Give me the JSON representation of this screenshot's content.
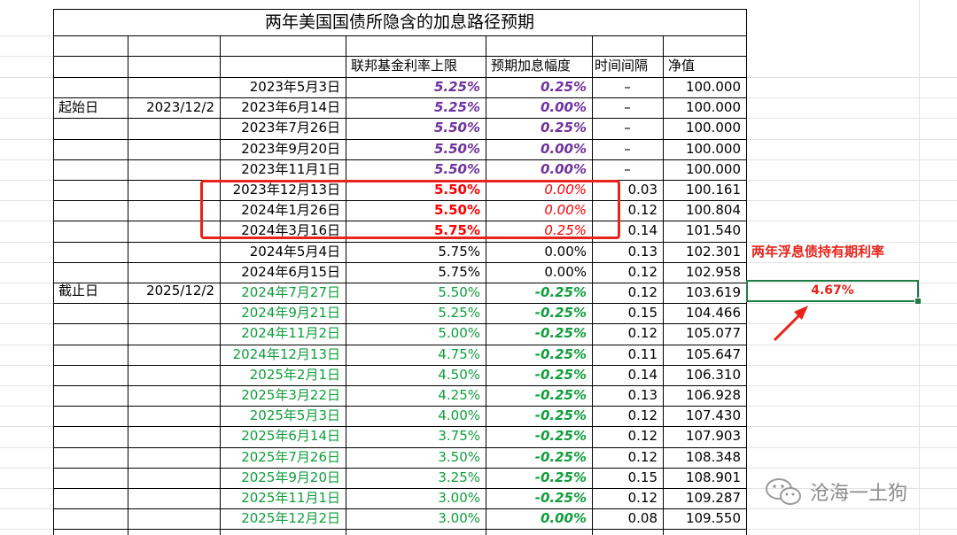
{
  "title": "两年美国国债所隐含的加息路径预期",
  "headers": {
    "fed_cap": "联邦基金利率上限",
    "hike": "预期加息幅度",
    "interval": "时间间隔",
    "nav": "净值"
  },
  "side_labels": {
    "start": {
      "label": "起始日",
      "date": "2023/12/2"
    },
    "end": {
      "label": "截止日",
      "date": "2025/12/2"
    }
  },
  "rows": [
    {
      "date": "2023年5月3日",
      "rate": "5.25%",
      "hike": "0.25%",
      "interval": "–",
      "nav": "100.000",
      "style": "past"
    },
    {
      "date": "2023年6月14日",
      "rate": "5.25%",
      "hike": "0.00%",
      "interval": "–",
      "nav": "100.000",
      "style": "past"
    },
    {
      "date": "2023年7月26日",
      "rate": "5.50%",
      "hike": "0.25%",
      "interval": "–",
      "nav": "100.000",
      "style": "past"
    },
    {
      "date": "2023年9月20日",
      "rate": "5.50%",
      "hike": "0.00%",
      "interval": "–",
      "nav": "100.000",
      "style": "past"
    },
    {
      "date": "2023年11月1日",
      "rate": "5.50%",
      "hike": "0.00%",
      "interval": "–",
      "nav": "100.000",
      "style": "past"
    },
    {
      "date": "2023年12月13日",
      "rate": "5.50%",
      "hike": "0.00%",
      "interval": "0.03",
      "nav": "100.161",
      "style": "red"
    },
    {
      "date": "2024年1月26日",
      "rate": "5.50%",
      "hike": "0.00%",
      "interval": "0.12",
      "nav": "100.804",
      "style": "red"
    },
    {
      "date": "2024年3月16日",
      "rate": "5.75%",
      "hike": "0.25%",
      "interval": "0.14",
      "nav": "101.540",
      "style": "red"
    },
    {
      "date": "2024年5月4日",
      "rate": "5.75%",
      "hike": "0.00%",
      "interval": "0.13",
      "nav": "102.301",
      "style": "plain"
    },
    {
      "date": "2024年6月15日",
      "rate": "5.75%",
      "hike": "0.00%",
      "interval": "0.12",
      "nav": "102.958",
      "style": "plain"
    },
    {
      "date": "2024年7月27日",
      "rate": "5.50%",
      "hike": "-0.25%",
      "interval": "0.12",
      "nav": "103.619",
      "style": "green"
    },
    {
      "date": "2024年9月21日",
      "rate": "5.25%",
      "hike": "-0.25%",
      "interval": "0.15",
      "nav": "104.466",
      "style": "green"
    },
    {
      "date": "2024年11月2日",
      "rate": "5.00%",
      "hike": "-0.25%",
      "interval": "0.12",
      "nav": "105.077",
      "style": "green"
    },
    {
      "date": "2024年12月13日",
      "rate": "4.75%",
      "hike": "-0.25%",
      "interval": "0.11",
      "nav": "105.647",
      "style": "green"
    },
    {
      "date": "2025年2月1日",
      "rate": "4.50%",
      "hike": "-0.25%",
      "interval": "0.14",
      "nav": "106.310",
      "style": "green"
    },
    {
      "date": "2025年3月22日",
      "rate": "4.25%",
      "hike": "-0.25%",
      "interval": "0.13",
      "nav": "106.928",
      "style": "green"
    },
    {
      "date": "2025年5月3日",
      "rate": "4.00%",
      "hike": "-0.25%",
      "interval": "0.12",
      "nav": "107.430",
      "style": "green"
    },
    {
      "date": "2025年6月14日",
      "rate": "3.75%",
      "hike": "-0.25%",
      "interval": "0.12",
      "nav": "107.903",
      "style": "green"
    },
    {
      "date": "2025年7月26日",
      "rate": "3.50%",
      "hike": "-0.25%",
      "interval": "0.12",
      "nav": "108.348",
      "style": "green"
    },
    {
      "date": "2025年9月20日",
      "rate": "3.25%",
      "hike": "-0.25%",
      "interval": "0.15",
      "nav": "108.901",
      "style": "green"
    },
    {
      "date": "2025年11月1日",
      "rate": "3.00%",
      "hike": "-0.25%",
      "interval": "0.12",
      "nav": "109.287",
      "style": "green"
    },
    {
      "date": "2025年12月2日",
      "rate": "3.00%",
      "hike": "0.00%",
      "interval": "0.08",
      "nav": "109.550",
      "style": "green"
    }
  ],
  "annotation": {
    "label": "两年浮息债持有期利率",
    "value": "4.67%"
  },
  "watermark": {
    "text": "沧海一土狗",
    "icon": "wechat-icon"
  },
  "colors": {
    "purple": "#7030a0",
    "red": "#ff0000",
    "green": "#0e9e3a",
    "black": "#000000",
    "annotation_red": "#e8231a",
    "selection_green": "#1e7b45"
  }
}
